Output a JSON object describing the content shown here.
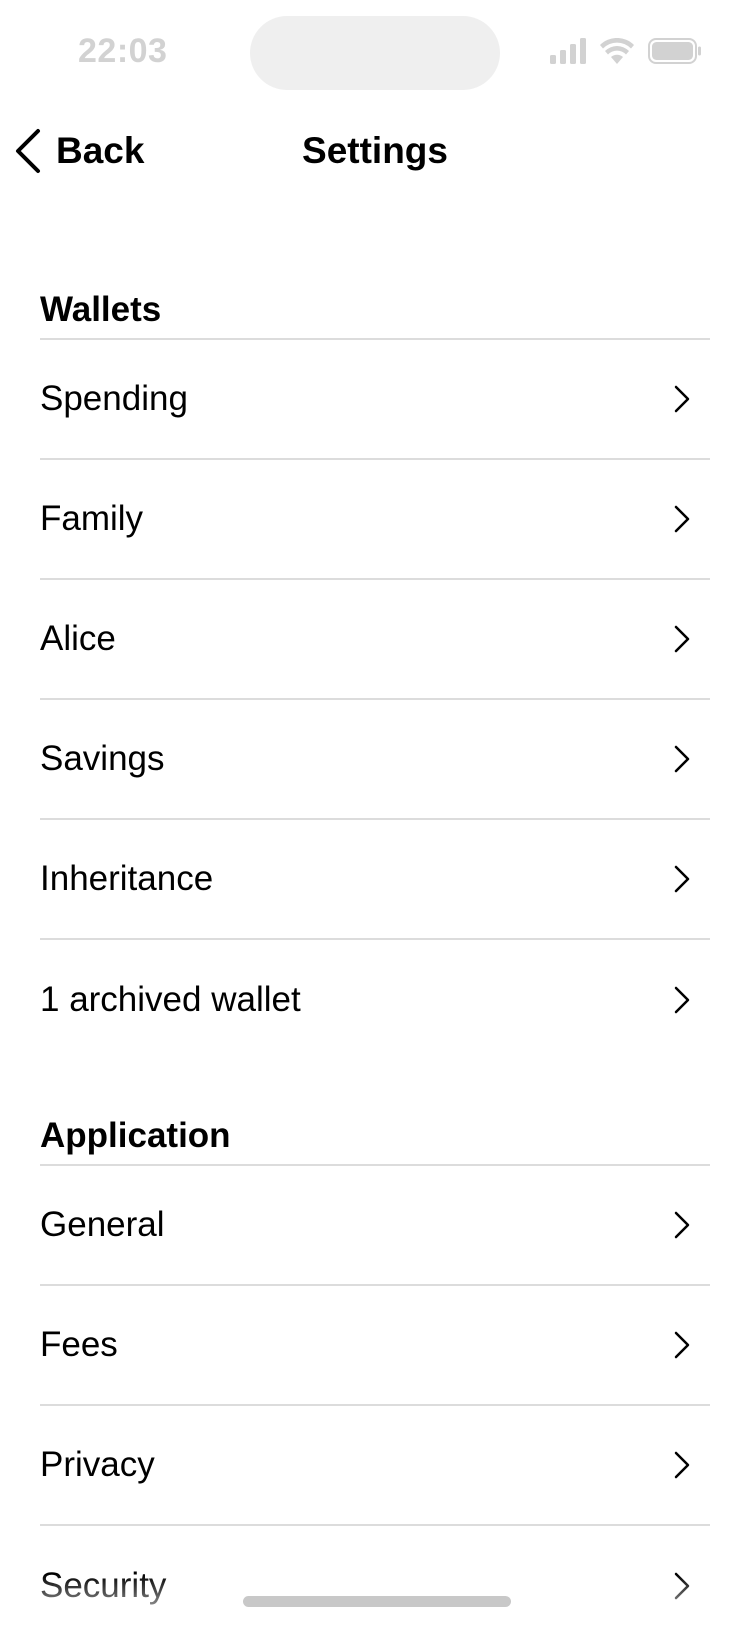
{
  "status_bar": {
    "time": "22:03",
    "icons": [
      "cellular-signal-icon",
      "wifi-icon",
      "battery-icon"
    ],
    "icon_color": "#d2d2d2"
  },
  "nav": {
    "back_label": "Back",
    "title": "Settings"
  },
  "sections": {
    "wallets": {
      "title": "Wallets",
      "items": [
        {
          "label": "Spending"
        },
        {
          "label": "Family"
        },
        {
          "label": "Alice"
        },
        {
          "label": "Savings"
        },
        {
          "label": "Inheritance"
        },
        {
          "label": "1 archived wallet"
        }
      ]
    },
    "application": {
      "title": "Application",
      "items": [
        {
          "label": "General"
        },
        {
          "label": "Fees"
        },
        {
          "label": "Privacy"
        },
        {
          "label": "Security"
        }
      ]
    }
  },
  "colors": {
    "divider": "#dcdcdc",
    "text": "#000000",
    "background": "#ffffff"
  }
}
